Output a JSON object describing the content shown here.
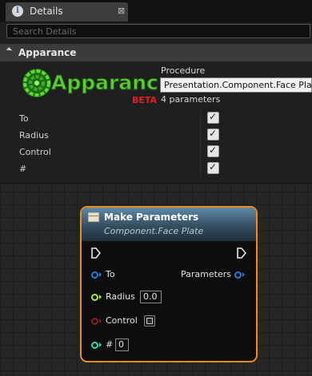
{
  "details_panel": {
    "tab_label": "Details",
    "tab_icon": "info-icon",
    "tab_close": "⊠",
    "search_placeholder": "Search Details",
    "category": "Apparance",
    "logo": {
      "text": "Apparance",
      "badge": "BETA"
    },
    "procedure_label": "Procedure",
    "procedure_value": "Presentation.Component.Face Plate",
    "parameter_count": "4 parameters",
    "parameters": [
      {
        "label": "To",
        "checked": true
      },
      {
        "label": "Radius",
        "checked": true
      },
      {
        "label": "Control",
        "checked": true
      },
      {
        "label": "#",
        "checked": true
      }
    ]
  },
  "node": {
    "title": "Make Parameters",
    "subtitle": "Component.Face Plate",
    "inputs": [
      {
        "label": "To",
        "type": "object",
        "color": "#2d7bd8"
      },
      {
        "label": "Radius",
        "type": "float",
        "color": "#a8e84a",
        "value": "0.0"
      },
      {
        "label": "Control",
        "type": "bool",
        "color": "#8f1d1d"
      },
      {
        "label": "#",
        "type": "int",
        "color": "#2ad8b0",
        "value": "0"
      }
    ],
    "output": {
      "label": "Parameters",
      "color": "#2d7bd8"
    }
  },
  "colors": {
    "accent": "#e88f1c",
    "node_header": "#4a6d86",
    "logo_green": "#3eb82a",
    "logo_red": "#e02020"
  }
}
